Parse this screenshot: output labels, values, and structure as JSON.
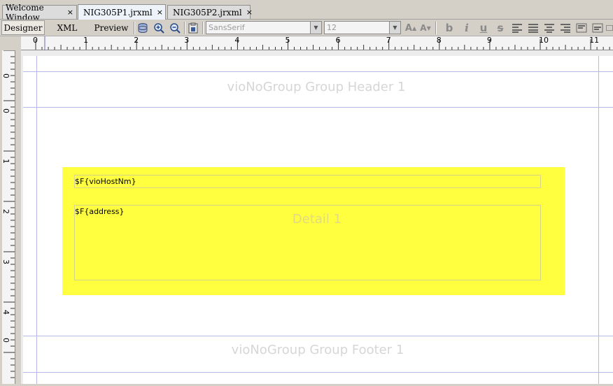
{
  "tabs": [
    {
      "label": "Welcome Window",
      "close": "×",
      "active": false
    },
    {
      "label": "NIG305P1.jrxml",
      "close": "×",
      "active": true
    },
    {
      "label": "NIG305P2.jrxml",
      "close": "×",
      "active": false
    }
  ],
  "view_tabs": {
    "designer": "Designer",
    "xml": "XML",
    "preview": "Preview"
  },
  "toolbar": {
    "font_name": "SansSerif",
    "font_size": "12",
    "bold": "b",
    "italic": "i",
    "underline": "u",
    "strike": "s"
  },
  "ruler": {
    "h_labels": [
      "0",
      "1",
      "2",
      "3",
      "4",
      "5",
      "6",
      "7",
      "8",
      "9",
      "10",
      "11"
    ],
    "v_labels": [
      "0",
      "0",
      "1",
      "2",
      "3",
      "4",
      "0"
    ]
  },
  "report": {
    "group_header": "vioNoGroup Group Header 1",
    "detail_label": "Detail 1",
    "group_footer": "vioNoGroup Group Footer 1",
    "field_host": "$F{vioHostNm}",
    "field_address": "$F{address}"
  },
  "colors": {
    "detail_band": "#ffff40",
    "guide": "#b8b8e8"
  }
}
